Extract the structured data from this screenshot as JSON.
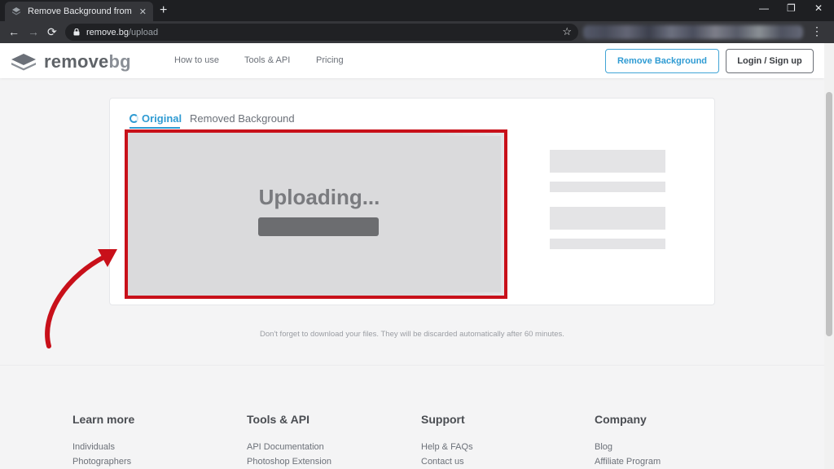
{
  "browser": {
    "tab_title": "Remove Background from Image",
    "url_host": "remove.bg",
    "url_path": "/upload"
  },
  "header": {
    "brand_main": "remove",
    "brand_accent": "bg",
    "nav": [
      "How to use",
      "Tools & API",
      "Pricing"
    ],
    "remove_button": "Remove Background",
    "login_button": "Login / Sign up"
  },
  "card": {
    "tab_original": "Original",
    "tab_removed": "Removed Background",
    "status": "Uploading..."
  },
  "notice": "Don't forget to download your files. They will be discarded automatically after 60 minutes.",
  "footer": {
    "learn_more": {
      "title": "Learn more",
      "links": [
        "Individuals",
        "Photographers"
      ]
    },
    "tools_api": {
      "title": "Tools & API",
      "links": [
        "API Documentation",
        "Photoshop Extension"
      ]
    },
    "support": {
      "title": "Support",
      "links": [
        "Help & FAQs",
        "Contact us"
      ]
    },
    "company": {
      "title": "Company",
      "links": [
        "Blog",
        "Affiliate Program"
      ]
    }
  },
  "colors": {
    "accent": "#2f9bd3",
    "highlight_red": "#c8101a"
  }
}
